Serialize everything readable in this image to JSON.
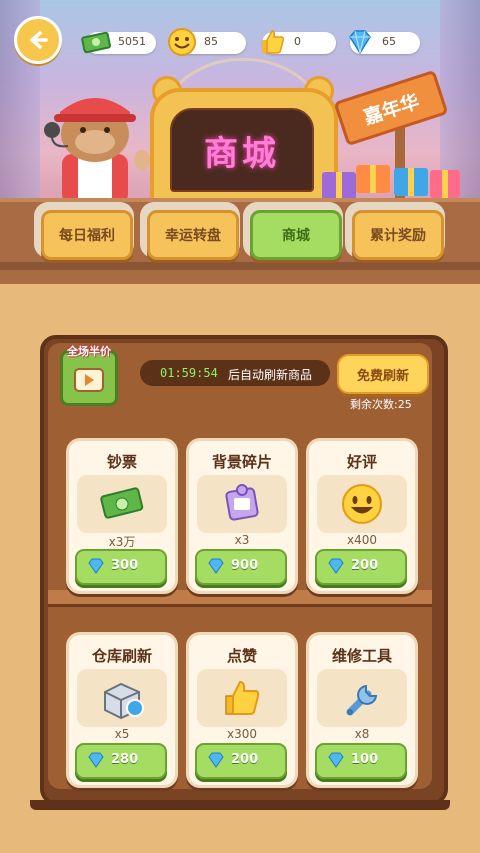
{
  "currency": {
    "cash": "5051",
    "smile": "85",
    "likes": "0",
    "diamonds": "65"
  },
  "sign": {
    "title": "商城",
    "carnival": "嘉年华"
  },
  "tabs": [
    {
      "label": "每日福利",
      "active": false
    },
    {
      "label": "幸运转盘",
      "active": false
    },
    {
      "label": "商城",
      "active": true
    },
    {
      "label": "累计奖励",
      "active": false
    }
  ],
  "shop": {
    "badge_label": "全场半价",
    "timer": "01:59:54",
    "timer_text": "后自动刷新商品",
    "refresh_button": "免费刷新",
    "remaining": "剩余次数:25",
    "items": [
      {
        "name": "钞票",
        "icon": "cash-icon",
        "qty": "x3万",
        "price": "300"
      },
      {
        "name": "背景碎片",
        "icon": "puzzle-piece-icon",
        "qty": "x3",
        "price": "900"
      },
      {
        "name": "好评",
        "icon": "smile-icon",
        "qty": "x400",
        "price": "200"
      },
      {
        "name": "仓库刷新",
        "icon": "warehouse-box-icon",
        "qty": "x5",
        "price": "280"
      },
      {
        "name": "点赞",
        "icon": "thumbs-up-icon",
        "qty": "x300",
        "price": "200"
      },
      {
        "name": "维修工具",
        "icon": "wrench-icon",
        "qty": "x8",
        "price": "100"
      }
    ]
  },
  "colors": {
    "accent_green": "#a5dc62",
    "accent_yellow": "#f6c35b",
    "sign_text": "#ff7fd6",
    "shelf_brown": "#7a4424"
  }
}
